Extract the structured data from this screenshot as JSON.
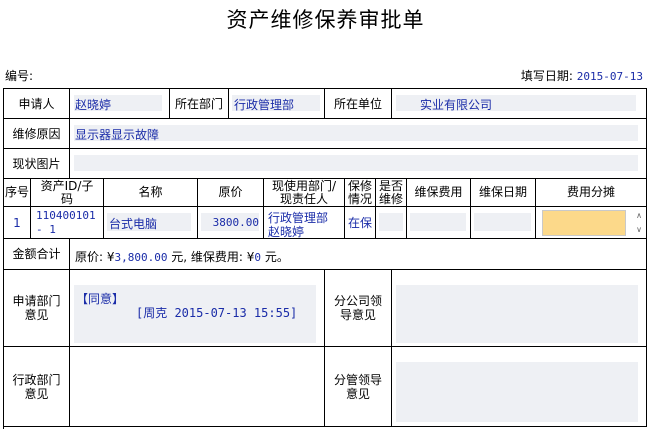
{
  "title": "资产维修保养审批单",
  "number_label": "编号:",
  "fill_date_label": "填写日期:",
  "fill_date": "2015-07-13",
  "applicant_label": "申请人",
  "applicant": "赵晓婷",
  "dept_label": "所在部门",
  "dept": "行政管理部",
  "unit_label": "所在单位",
  "unit": "实业有限公司",
  "reason_label": "维修原因",
  "reason": "显示器显示故障",
  "photo_label": "现状图片",
  "table": {
    "headers": {
      "no": "序号",
      "asset_id": "资产ID/子码",
      "name": "名称",
      "price": "原价",
      "user": "现使用部门/现责任人",
      "warranty": "保修情况",
      "repair": "是否维修",
      "cost": "维保费用",
      "date": "维保日期",
      "share": "费用分摊"
    },
    "row": {
      "no": "1",
      "asset_id_1": "110400101",
      "asset_id_2": "- 1",
      "name": "台式电脑",
      "price": "3800.00",
      "user_dept": "行政管理部",
      "user_name": "赵晓婷",
      "warranty": "在保",
      "repair": "",
      "cost": "",
      "date": "",
      "share": ""
    }
  },
  "total": {
    "label": "金额合计",
    "prefix": "原价: ¥",
    "original": "3,800.00",
    "mid": " 元, 维保费用: ¥",
    "maintenance": "0",
    "suffix": " 元。"
  },
  "opinions": {
    "apply_dept_label": "申请部门意见",
    "apply_dept_status": "【同意】",
    "apply_dept_sign": "[周克 2015-07-13 15:55]",
    "branch_leader_label": "分公司领导意见",
    "admin_dept_label": "行政部门意见",
    "charge_leader_label": "分管领导意见"
  },
  "colors": {
    "value_text": "#1a2ca8",
    "highlight": "#fcd98a",
    "field_bg": "#eef0f4"
  }
}
